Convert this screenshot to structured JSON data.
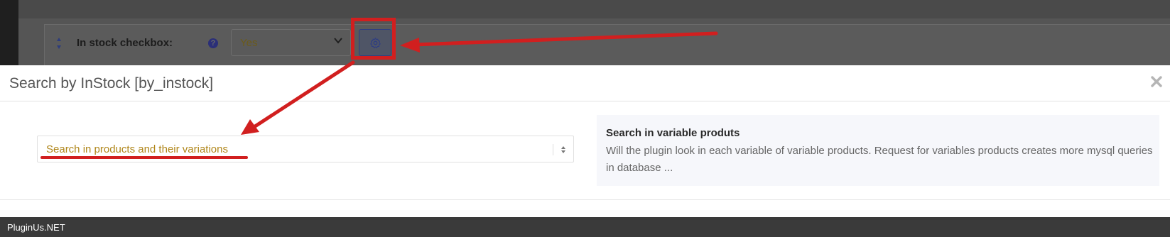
{
  "background": {
    "row": {
      "label": "In stock checkbox:",
      "help_icon": "question-circle-icon",
      "select_value": "Yes",
      "settings_icon": "gear-icon"
    }
  },
  "modal": {
    "title": "Search by InStock [by_instock]",
    "close_icon": "close-icon",
    "select_value": "Search in products and their variations",
    "info": {
      "title": "Search in variable produts",
      "description": "Will the plugin look in each variable of variable products. Request for variables products creates more mysql queries in database ..."
    }
  },
  "footer": {
    "brand": "PluginUs.NET"
  },
  "colors": {
    "annotation_red": "#d11f1f",
    "accent_blue": "#2f3e82",
    "select_text_gold": "#b0861a"
  }
}
